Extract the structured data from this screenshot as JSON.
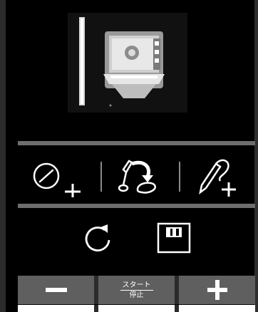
{
  "app": {
    "accent_color": "#ffffff",
    "background_color": "#000000",
    "separator_color": "#6d6d6d"
  },
  "preview": {
    "icon": "camera-preview-image"
  },
  "icons_row1": [
    {
      "icon": "add-timer-icon"
    },
    {
      "icon": "draw-stroke-icon"
    },
    {
      "icon": "add-pen-icon"
    }
  ],
  "icons_row2": [
    {
      "icon": "refresh-icon"
    },
    {
      "icon": "save-icon"
    }
  ],
  "bottom": {
    "minus_icon": "minus-icon",
    "start_label": "スタート",
    "stop_label": "停止",
    "plus_icon": "plus-icon"
  }
}
